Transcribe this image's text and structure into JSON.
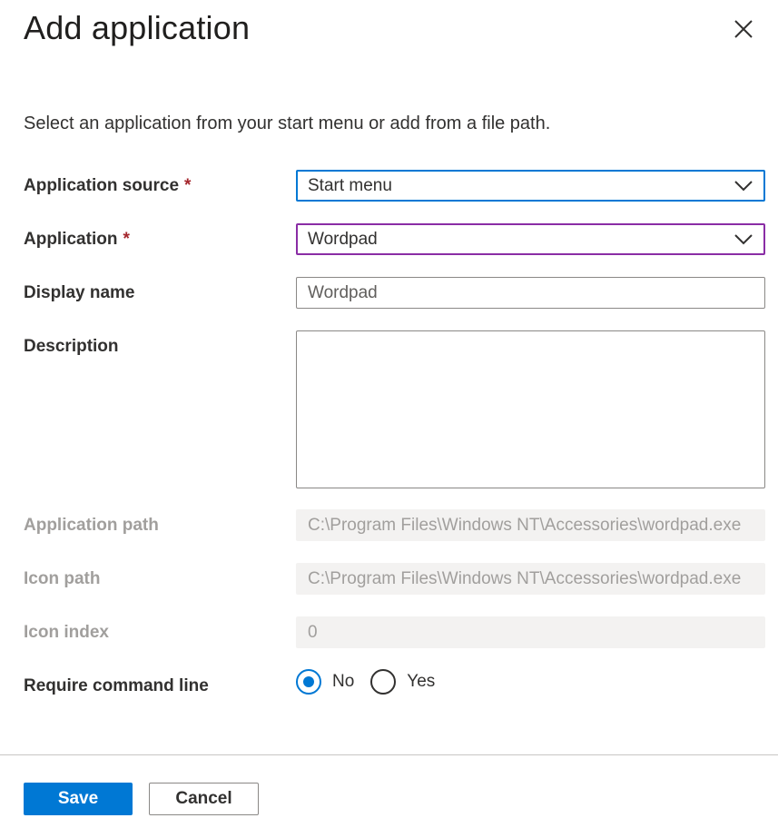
{
  "dialog": {
    "title": "Add application",
    "intro": "Select an application from your start menu or add from a file path."
  },
  "fields": {
    "application_source": {
      "label": "Application source",
      "required_mark": "*",
      "value": "Start menu"
    },
    "application": {
      "label": "Application",
      "required_mark": "*",
      "value": "Wordpad"
    },
    "display_name": {
      "label": "Display name",
      "value": "Wordpad"
    },
    "description": {
      "label": "Description",
      "value": ""
    },
    "application_path": {
      "label": "Application path",
      "value": "C:\\Program Files\\Windows NT\\Accessories\\wordpad.exe"
    },
    "icon_path": {
      "label": "Icon path",
      "value": "C:\\Program Files\\Windows NT\\Accessories\\wordpad.exe"
    },
    "icon_index": {
      "label": "Icon index",
      "value": "0"
    },
    "require_command_line": {
      "label": "Require command line",
      "options": [
        {
          "label": "No",
          "checked": true
        },
        {
          "label": "Yes",
          "checked": false
        }
      ]
    }
  },
  "footer": {
    "save_label": "Save",
    "cancel_label": "Cancel"
  },
  "icons": {
    "close": "close-icon",
    "chevron": "chevron-down-icon"
  },
  "colors": {
    "primary": "#0078d4",
    "required": "#a4262c",
    "focus_purple": "#8a2da5",
    "disabled_bg": "#f3f2f1"
  }
}
